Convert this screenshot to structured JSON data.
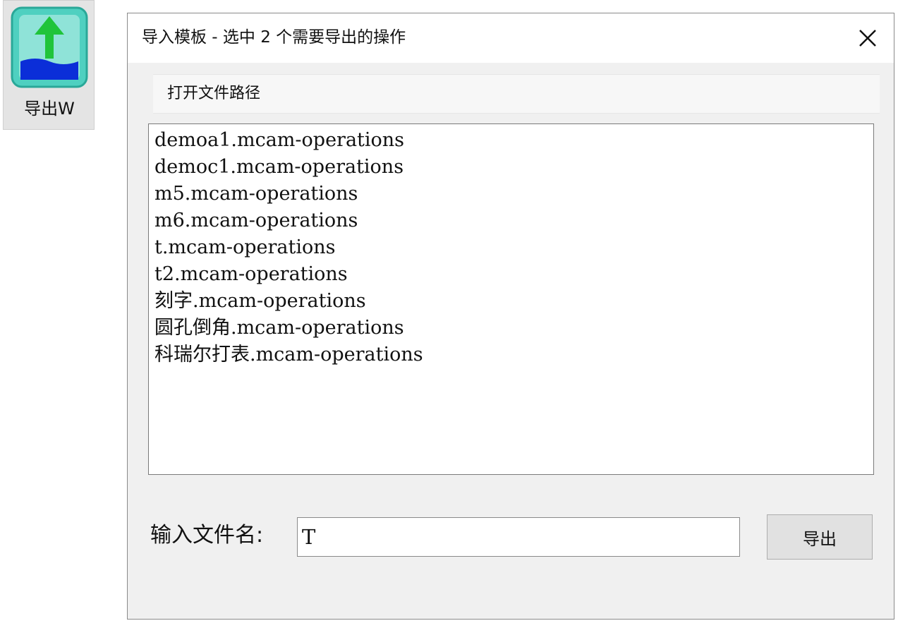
{
  "toolbar": {
    "export_label": "导出W",
    "icon_name": "export-arrow-up-icon"
  },
  "dialog": {
    "title": "导入模板 - 选中 2 个需要导出的操作",
    "close_icon": "close-icon",
    "open_path_label": "打开文件路径",
    "files": [
      "demoa1.mcam-operations",
      "democ1.mcam-operations",
      "m5.mcam-operations",
      "m6.mcam-operations",
      "t.mcam-operations",
      "t2.mcam-operations",
      "刻字.mcam-operations",
      "圆孔倒角.mcam-operations",
      "科瑞尔打表.mcam-operations"
    ],
    "filename_label": "输入文件名:",
    "filename_value": "T",
    "export_button": "导出"
  },
  "colors": {
    "icon_teal": "#4fd0c0",
    "icon_arrow": "#1fc43a",
    "icon_water": "#0b2ed8",
    "dialog_bg": "#f0f0f0"
  }
}
